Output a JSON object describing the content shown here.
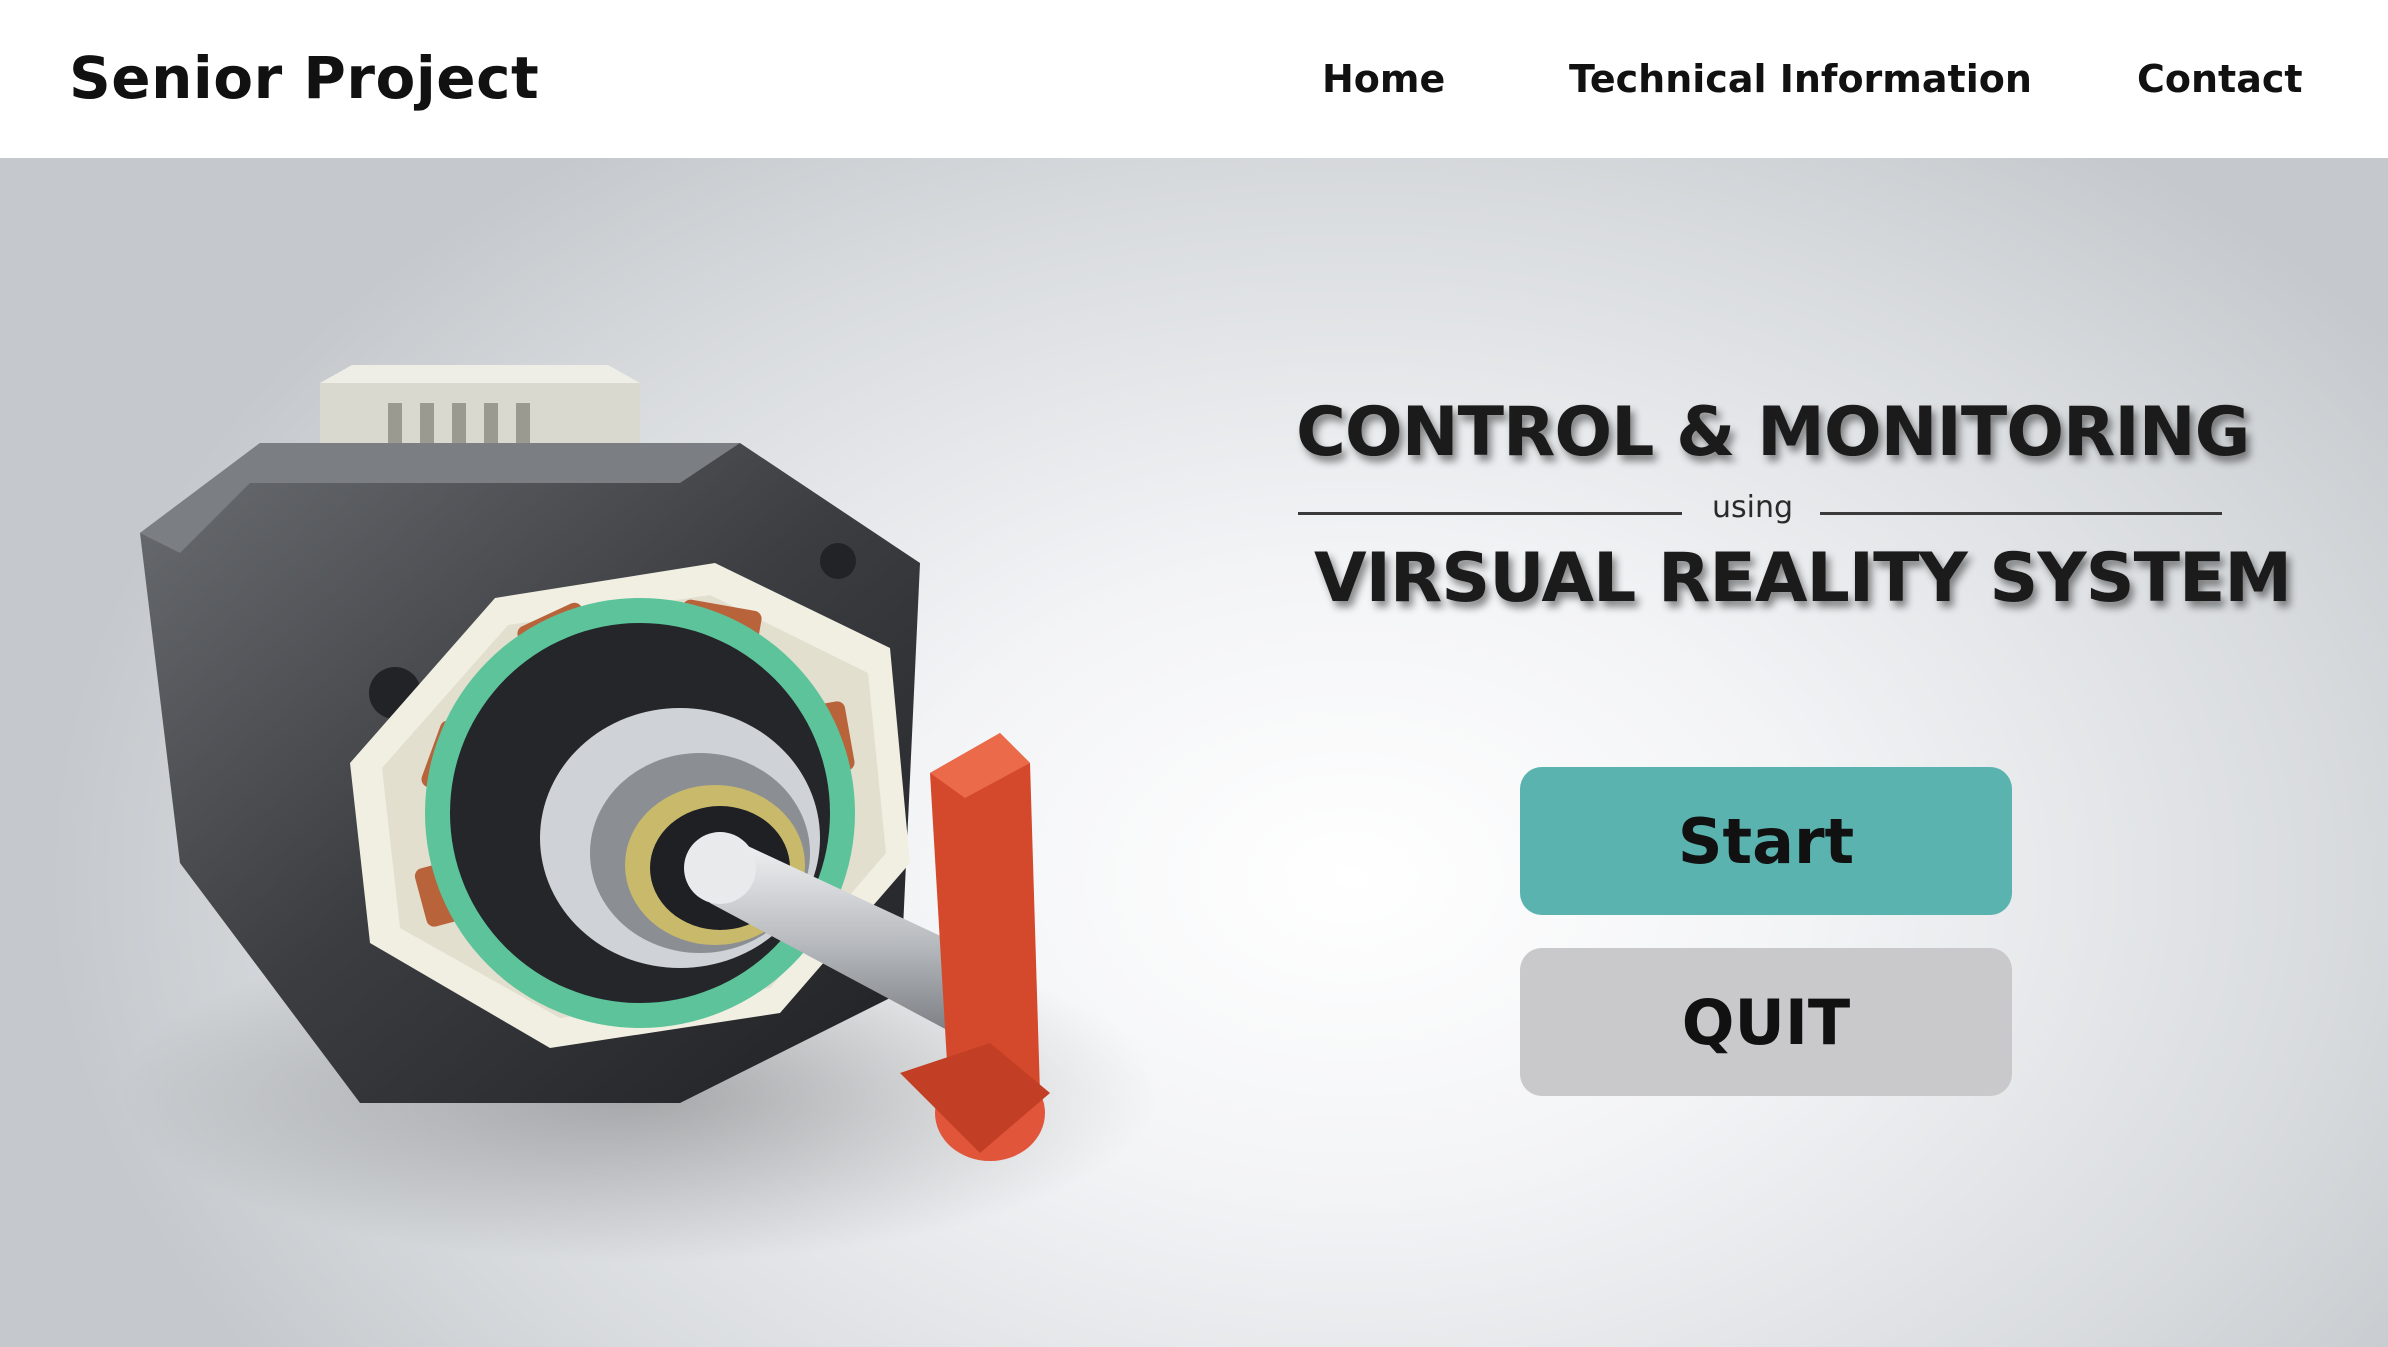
{
  "header": {
    "brand": "Senior Project",
    "nav": {
      "home": "Home",
      "technical_information": "Technical Information",
      "contact": "Contact"
    }
  },
  "hero": {
    "title_line1": "CONTROL & MONITORING",
    "connector": "using",
    "title_line2": "VIRSUAL REALITY SYSTEM",
    "image": "stepper-motor-cutaway-illustration"
  },
  "buttons": {
    "start": "Start",
    "quit": "QUIT"
  },
  "colors": {
    "start_button": "#5ab3ae",
    "quit_button": "#c9c9cb",
    "header_bg": "#ffffff",
    "text": "#111111"
  }
}
